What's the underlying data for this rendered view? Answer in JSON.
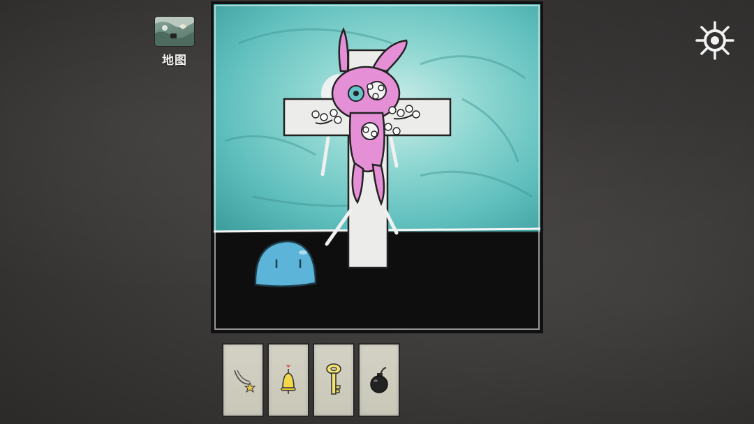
{
  "hud": {
    "map_label": "地图",
    "map_icon": "map-thumbnail-icon",
    "settings_icon": "gear-icon"
  },
  "scene": {
    "description_icons": [
      "pink-rabbit-on-cross",
      "blue-slime"
    ],
    "colors": {
      "sky": "#6fc6c4",
      "ground": "#0f0f0f",
      "cross": "#e9e9e6",
      "rabbit": "#e58fd6",
      "slime": "#5cb5d8"
    }
  },
  "inventory": {
    "items": [
      {
        "id": "necklace",
        "icon": "necklace-icon"
      },
      {
        "id": "bell",
        "icon": "bell-icon"
      },
      {
        "id": "key",
        "icon": "key-icon"
      },
      {
        "id": "bomb",
        "icon": "bomb-icon"
      }
    ]
  }
}
